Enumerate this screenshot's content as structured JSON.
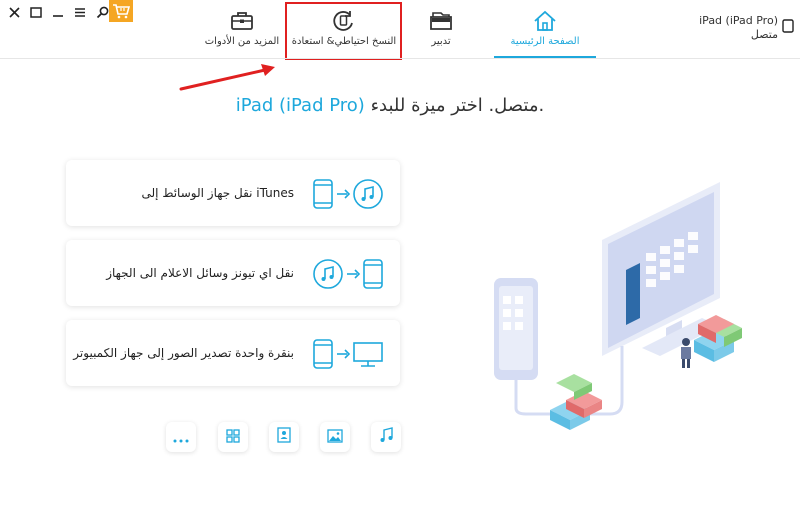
{
  "window": {
    "controls": [
      "close-icon",
      "maximize-icon",
      "minimize-icon",
      "menu-icon",
      "search-icon"
    ],
    "cart_color": "#f5a623"
  },
  "device": {
    "name": "iPad (iPad Pro)",
    "status": "متصل"
  },
  "tabs": [
    {
      "id": "tools",
      "label": "المزيد من الأدوات",
      "icon": "toolbox-icon"
    },
    {
      "id": "backup",
      "label": "النسخ احتياطي& استعادة",
      "icon": "backup-restore-icon"
    },
    {
      "id": "manage",
      "label": "تدبير",
      "icon": "folder-icon"
    },
    {
      "id": "home",
      "label": "الصفحة الرئيسية",
      "icon": "home-icon",
      "active": true
    }
  ],
  "headline": {
    "brand": "iPad (iPad Pro)",
    "text": " متصل. اختر ميزة للبدء."
  },
  "cards": [
    {
      "label": "نقل جهاز الوسائط إلى iTunes",
      "icons": [
        "phone-icon",
        "arrow-right-icon",
        "music-icon"
      ]
    },
    {
      "label": "نقل اي تيونز وسائل الاعلام الى الجهاز",
      "icons": [
        "music-icon",
        "arrow-right-icon",
        "phone-icon"
      ]
    },
    {
      "label": "بنقرة واحدة تصدير الصور إلى جهاز الكمبيوتر",
      "icons": [
        "phone-icon",
        "arrow-right-icon",
        "monitor-icon"
      ]
    }
  ],
  "mini_buttons": [
    "more-icon",
    "apps-icon",
    "contacts-icon",
    "photos-icon",
    "music-icon"
  ],
  "colors": {
    "accent": "#1ea8dc",
    "highlight": "#e02020"
  }
}
